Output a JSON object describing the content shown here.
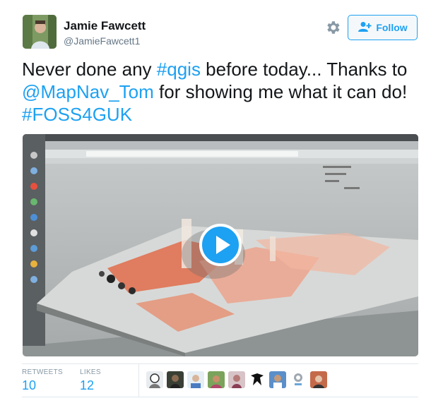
{
  "author": {
    "name": "Jamie Fawcett",
    "handle": "@JamieFawcett1"
  },
  "actions": {
    "follow_label": "Follow",
    "settings_icon": "gear-icon",
    "follow_icon": "person-plus-icon"
  },
  "tweet": {
    "text_1": "Never done any ",
    "hashtag_qgis": "#qgis",
    "text_2": " before today... Thanks to ",
    "mention": "@MapNav_Tom",
    "text_3": " for showing me what it can do! ",
    "hashtag_foss": "#FOSS4GUK"
  },
  "media": {
    "type": "video",
    "play_icon": "play-icon"
  },
  "stats": {
    "retweets_label": "RETWEETS",
    "retweets_value": "10",
    "likes_label": "LIKES",
    "likes_value": "12"
  },
  "colors": {
    "accent": "#1da1f2",
    "text": "#14171a",
    "muted": "#657786"
  }
}
